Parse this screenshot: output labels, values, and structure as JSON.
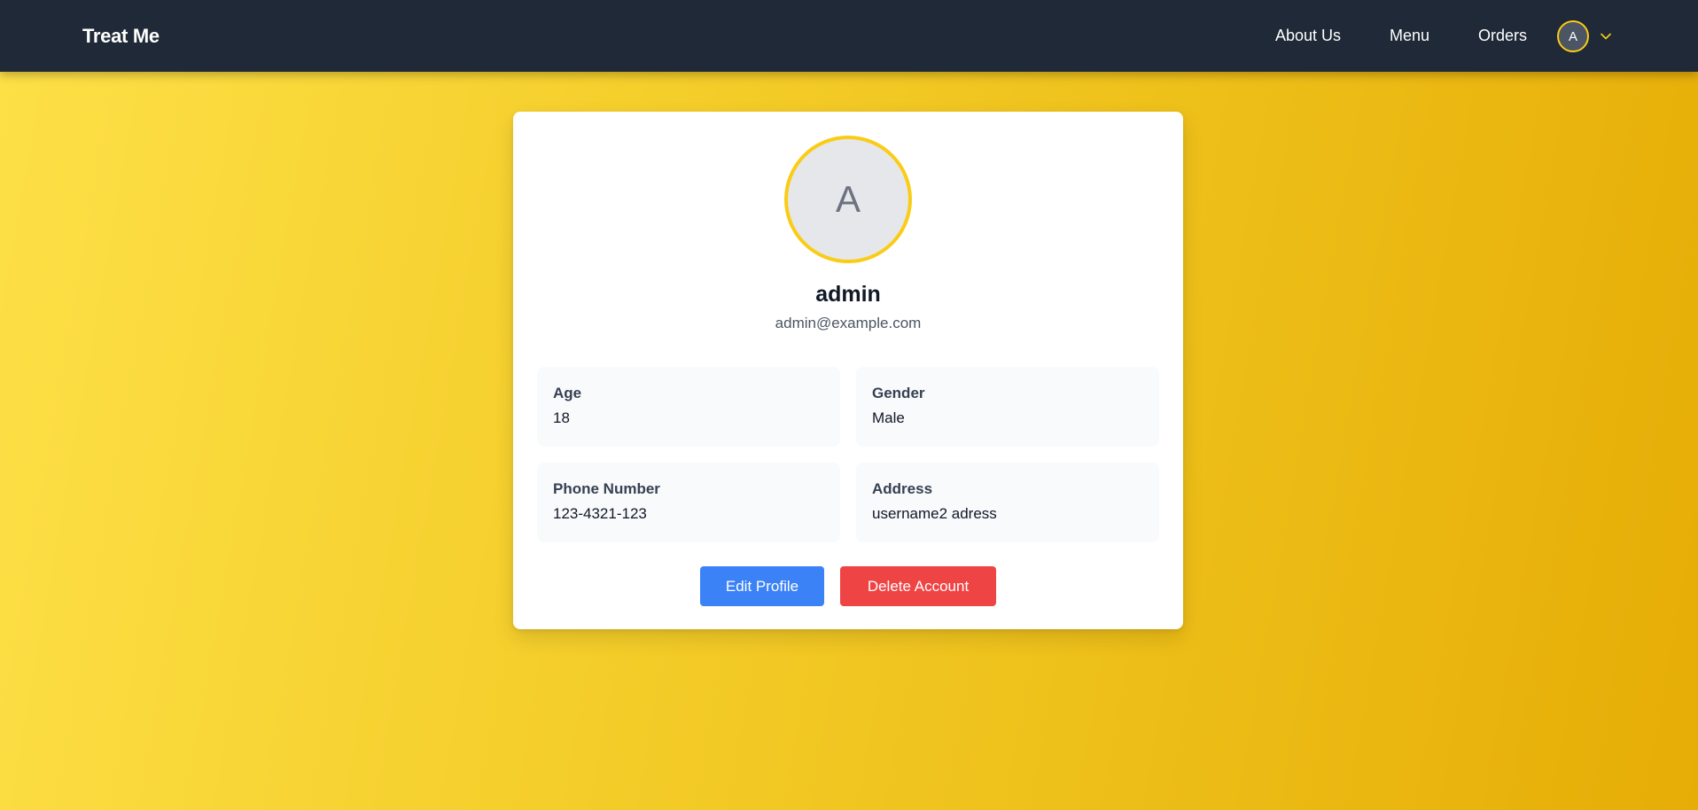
{
  "navbar": {
    "brand": "Treat Me",
    "links": [
      {
        "label": "About Us"
      },
      {
        "label": "Menu"
      },
      {
        "label": "Orders"
      }
    ],
    "user_initial": "A",
    "dropdown_icon": "chevron-down-icon"
  },
  "profile": {
    "avatar_initial": "A",
    "name": "admin",
    "email": "admin@example.com",
    "fields": {
      "age": {
        "label": "Age",
        "value": "18"
      },
      "gender": {
        "label": "Gender",
        "value": "Male"
      },
      "phone": {
        "label": "Phone Number",
        "value": "123-4321-123"
      },
      "address": {
        "label": "Address",
        "value": "username2 adress"
      }
    }
  },
  "actions": {
    "edit_label": "Edit Profile",
    "delete_label": "Delete Account"
  },
  "colors": {
    "navbar": "#1f2937",
    "accent": "#facc15",
    "edit_button": "#3b82f6",
    "delete_button": "#ef4444"
  }
}
